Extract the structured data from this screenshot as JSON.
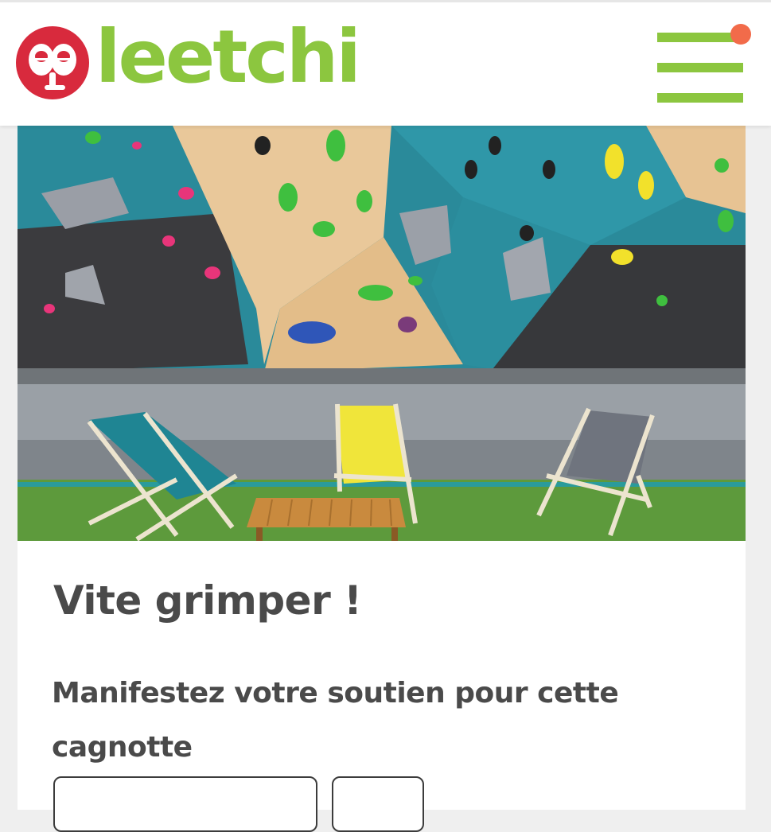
{
  "brand": {
    "name": "leetchi",
    "mark_text": "ee",
    "green": "#8cc63f",
    "red": "#d82a3d",
    "notification_dot": "#f26b4a"
  },
  "header": {
    "menu_icon": "hamburger-menu-icon",
    "has_notification": true
  },
  "campaign": {
    "image_description_icon": "climbing-gym-photo",
    "title": "Vite grimper !",
    "support_prompt": "Manifestez votre soutien pour cette cagnotte"
  }
}
